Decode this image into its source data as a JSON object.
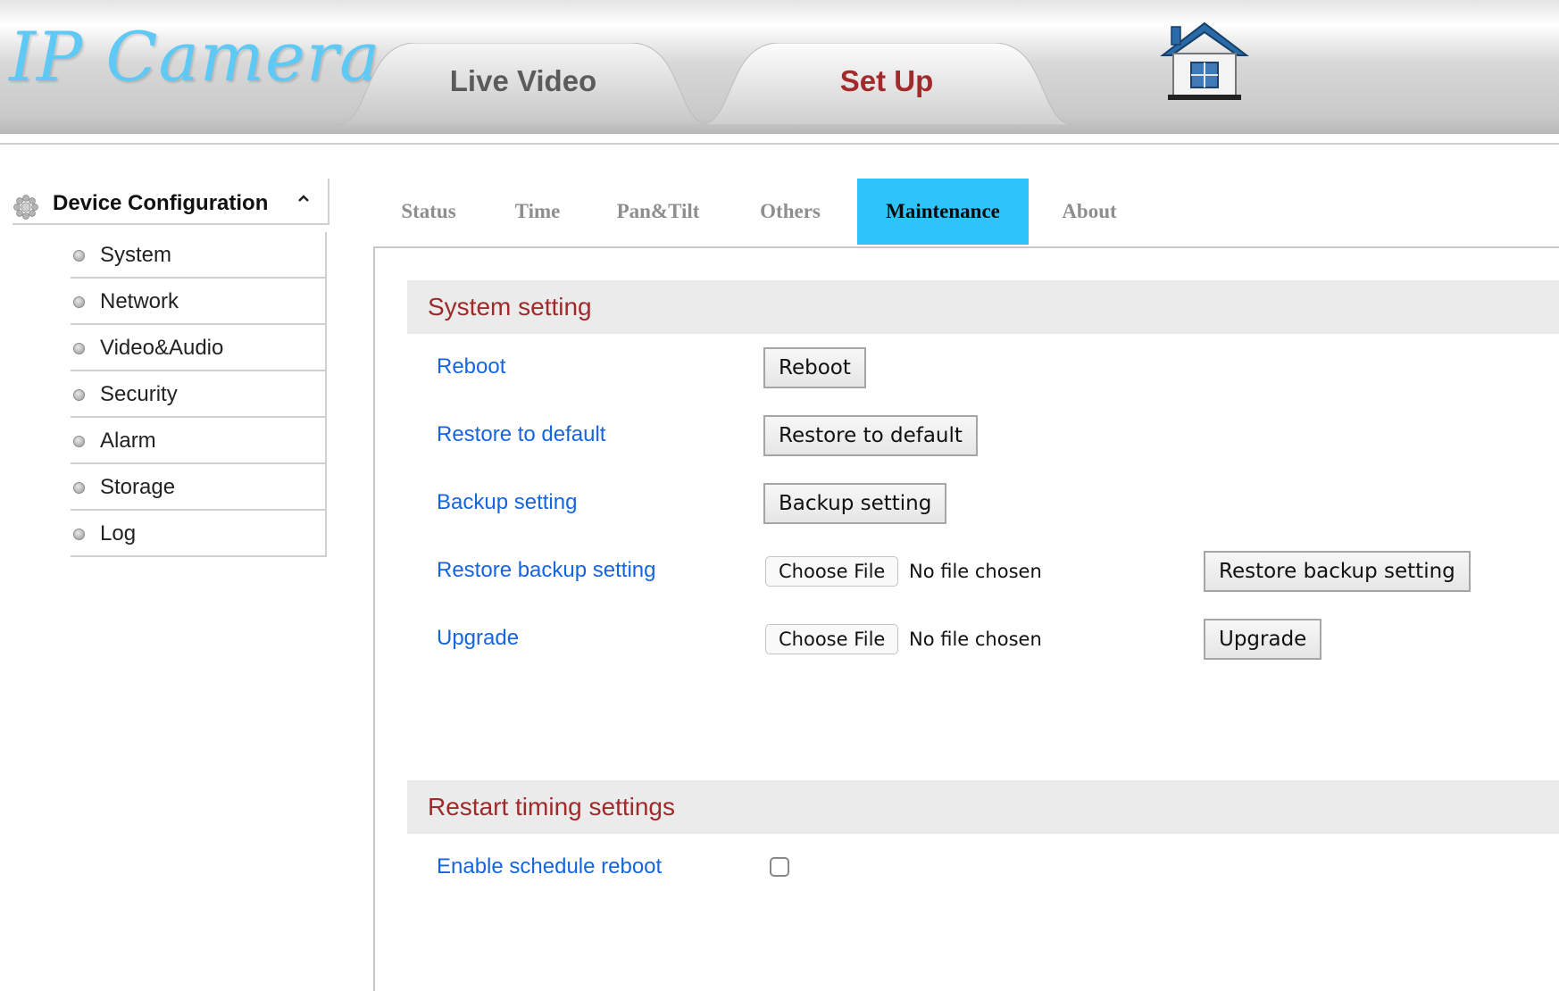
{
  "header": {
    "logo_text": "IP Camera",
    "tabs": [
      {
        "label": "Live Video",
        "active": false
      },
      {
        "label": "Set Up",
        "active": true
      }
    ],
    "home_icon": "home-icon"
  },
  "sidebar": {
    "title": "Device Configuration",
    "title_icon": "gear-icon",
    "toggle_icon": "chevron-up-icon",
    "items": [
      {
        "label": "System"
      },
      {
        "label": "Network"
      },
      {
        "label": "Video&Audio"
      },
      {
        "label": "Security"
      },
      {
        "label": "Alarm"
      },
      {
        "label": "Storage"
      },
      {
        "label": "Log"
      }
    ]
  },
  "sub_tabs": [
    {
      "label": "Status",
      "active": false
    },
    {
      "label": "Time",
      "active": false
    },
    {
      "label": "Pan&Tilt",
      "active": false
    },
    {
      "label": "Others",
      "active": false
    },
    {
      "label": "Maintenance",
      "active": true
    },
    {
      "label": "About",
      "active": false
    }
  ],
  "system_setting": {
    "title": "System setting",
    "rows": [
      {
        "label": "Reboot",
        "button": "Reboot"
      },
      {
        "label": "Restore to default",
        "button": "Restore to default"
      },
      {
        "label": "Backup setting",
        "button": "Backup setting"
      },
      {
        "label": "Restore backup setting",
        "file_button": "Choose File",
        "file_status": "No file chosen",
        "button": "Restore backup setting"
      },
      {
        "label": "Upgrade",
        "file_button": "Choose File",
        "file_status": "No file chosen",
        "button": "Upgrade"
      }
    ]
  },
  "restart_timing": {
    "title": "Restart timing settings",
    "enable_label": "Enable schedule reboot",
    "enable_checked": false
  },
  "colors": {
    "active_subtab": "#2ec4fb",
    "section_title": "#a02a2a",
    "label_link": "#1565e0",
    "active_toptab": "#a32a2a",
    "logo": "#5fc9f5"
  }
}
